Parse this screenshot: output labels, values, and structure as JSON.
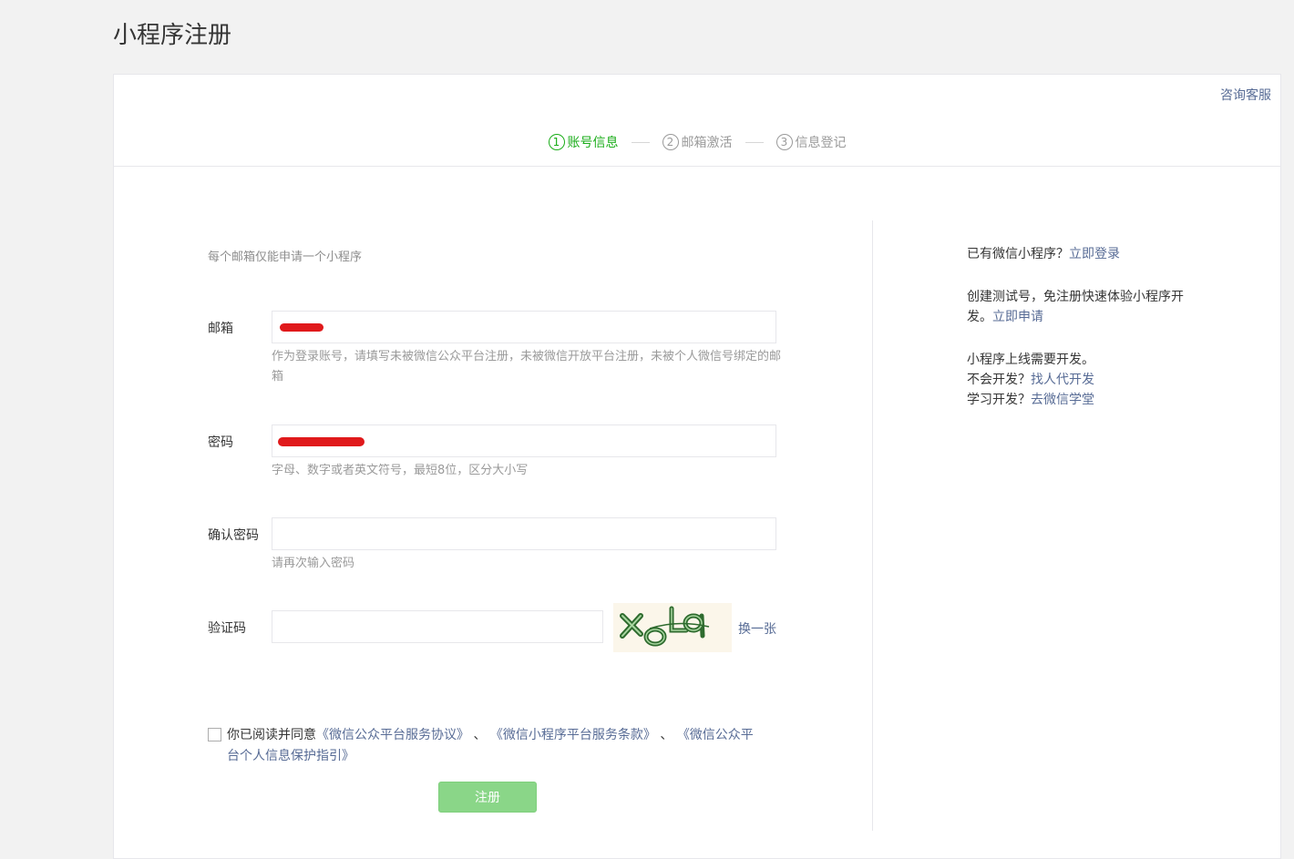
{
  "page": {
    "title": "小程序注册"
  },
  "header": {
    "consult_label": "咨询客服"
  },
  "steps": [
    {
      "num": "1",
      "label": "账号信息",
      "active": true
    },
    {
      "num": "2",
      "label": "邮箱激活",
      "active": false
    },
    {
      "num": "3",
      "label": "信息登记",
      "active": false
    }
  ],
  "form": {
    "notice": "每个邮箱仅能申请一个小程序",
    "email": {
      "label": "邮箱",
      "tip": "作为登录账号，请填写未被微信公众平台注册，未被微信开放平台注册，未被个人微信号绑定的邮箱"
    },
    "password": {
      "label": "密码",
      "tip": "字母、数字或者英文符号，最短8位，区分大小写"
    },
    "confirm": {
      "label": "确认密码",
      "tip": "请再次输入密码"
    },
    "captcha": {
      "label": "验证码",
      "image_text": "XoLq",
      "swap_label": "换一张"
    },
    "agreement": {
      "prefix": "你已阅读并同意",
      "link1": "《微信公众平台服务协议》",
      "sep1": " 、",
      "link2": "《微信小程序平台服务条款》",
      "sep2": " 、",
      "link3": "《微信公众平台个人信息保护指引》",
      "checked": false
    },
    "submit_label": "注册"
  },
  "side": {
    "login_prompt": "已有微信小程序？",
    "login_link": "立即登录",
    "test_text": "创建测试号，免注册快速体验小程序开发。",
    "test_link": "立即申请",
    "dev_line": "小程序上线需要开发。",
    "no_dev_prompt": "不会开发？",
    "no_dev_link": "找人代开发",
    "learn_prompt": "学习开发？",
    "learn_link": "去微信学堂"
  },
  "colors": {
    "accent_green": "#1aad19",
    "link_blue": "#576b95",
    "submit_disabled": "#8ad688",
    "redaction": "#e0191b"
  }
}
